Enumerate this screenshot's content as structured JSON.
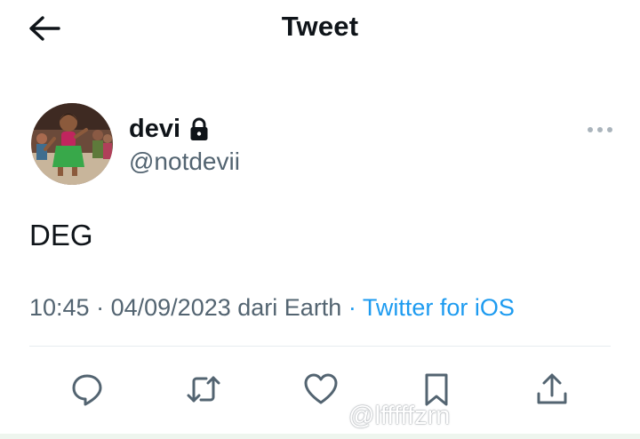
{
  "header": {
    "title": "Tweet",
    "back_icon": "arrow-left-icon"
  },
  "author": {
    "display_name": "devi",
    "handle": "@notdevii",
    "protected_icon": "lock-icon"
  },
  "tweet": {
    "text": "DEG",
    "time": "10:45",
    "date": "04/09/2023",
    "location_text": "dari Earth",
    "separator": "·",
    "source": "Twitter for iOS"
  },
  "actions": [
    {
      "name": "reply",
      "icon": "reply-icon"
    },
    {
      "name": "retweet",
      "icon": "retweet-icon"
    },
    {
      "name": "like",
      "icon": "heart-icon"
    },
    {
      "name": "bookmark",
      "icon": "bookmark-icon"
    },
    {
      "name": "share",
      "icon": "share-icon"
    }
  ],
  "watermark": {
    "text": "@lfffffzrn",
    "icon": "tiktok-icon"
  },
  "colors": {
    "link": "#1d9bf0",
    "secondary_text": "#536471",
    "primary_text": "#0f1419"
  }
}
